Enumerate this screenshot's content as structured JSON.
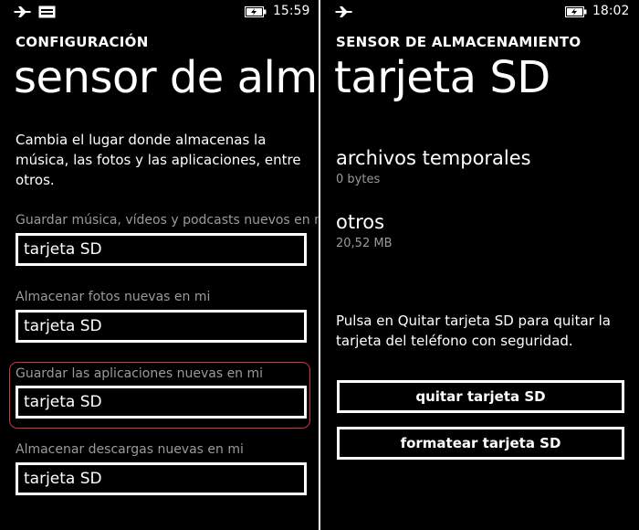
{
  "left": {
    "status": {
      "time": "15:59",
      "icons": [
        "airplane-icon",
        "message-icon",
        "battery-charging-icon"
      ]
    },
    "section_title": "CONFIGURACIÓN",
    "page_title": "sensor de almacenamiento",
    "description": "Cambia el lugar donde almacenas la música, las fotos y las aplicaciones, entre otros.",
    "fields": [
      {
        "label": "Guardar música, vídeos y podcasts nuevos en mi",
        "value": "tarjeta SD"
      },
      {
        "label": "Almacenar fotos nuevas en mi",
        "value": "tarjeta SD"
      },
      {
        "label": "Guardar las aplicaciones nuevas en mi",
        "value": "tarjeta SD"
      },
      {
        "label": "Almacenar descargas nuevas en mi",
        "value": "tarjeta SD"
      }
    ],
    "highlight_color": "#d0353a"
  },
  "right": {
    "status": {
      "time": "18:02",
      "icons": [
        "airplane-icon",
        "battery-charging-icon"
      ]
    },
    "section_title": "SENSOR DE ALMACENAMIENTO",
    "page_title": "tarjeta SD",
    "items": [
      {
        "title": "archivos temporales",
        "value": "0 bytes"
      },
      {
        "title": "otros",
        "value": "20,52 MB"
      }
    ],
    "info": "Pulsa en Quitar tarjeta SD para quitar la tarjeta del teléfono con seguridad.",
    "buttons": {
      "remove": "quitar tarjeta SD",
      "format": "formatear tarjeta SD"
    }
  }
}
